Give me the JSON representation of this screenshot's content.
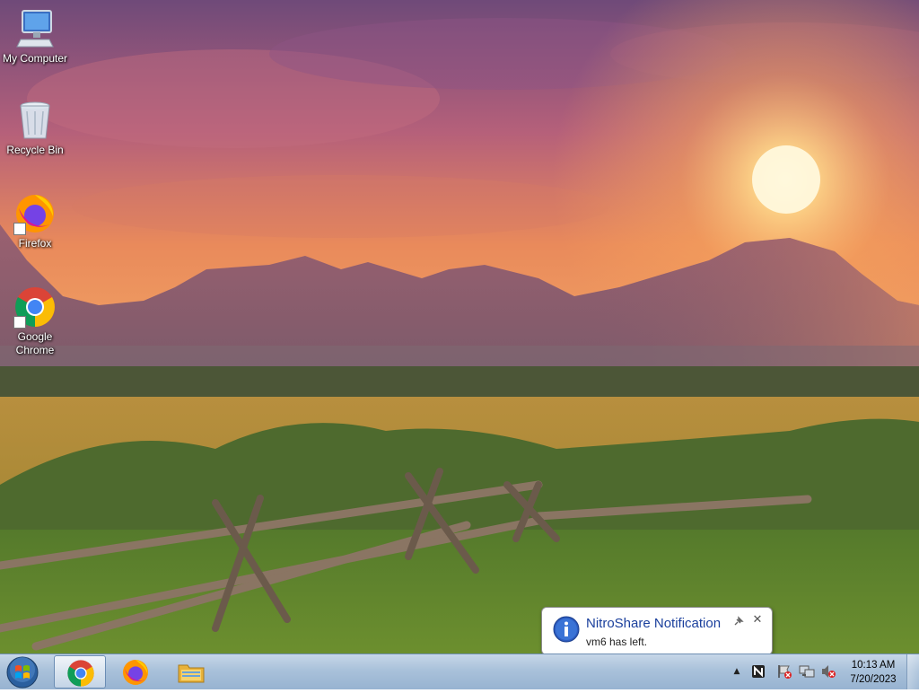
{
  "desktop": {
    "icons": [
      {
        "label": "My Computer",
        "icon": "computer-icon"
      },
      {
        "label": "Recycle Bin",
        "icon": "recycle-bin-icon"
      },
      {
        "label": "Firefox",
        "icon": "firefox-icon"
      },
      {
        "label": "Google\nChrome",
        "icon": "chrome-icon"
      }
    ]
  },
  "notification": {
    "title": "NitroShare Notification",
    "message": "vm6 has left.",
    "icon": "info-icon"
  },
  "taskbar": {
    "start": "windows-start-icon",
    "pinned": [
      {
        "app": "Google Chrome",
        "icon": "chrome-icon",
        "active": true
      },
      {
        "app": "Firefox",
        "icon": "firefox-icon",
        "active": false
      },
      {
        "app": "File Explorer",
        "icon": "folder-icon",
        "active": false
      }
    ],
    "tray": {
      "chevron": "▲",
      "icons": [
        "nitroshare-icon",
        "action-center-icon",
        "network-icon",
        "volume-muted-icon"
      ]
    },
    "clock": {
      "time": "10:13 AM",
      "date": "7/20/2023"
    }
  },
  "colors": {
    "taskbar": "#a9c1da",
    "balloon_title": "#1a3f9c",
    "sky_top": "#7a4a78",
    "sun": "#fff2c4"
  }
}
